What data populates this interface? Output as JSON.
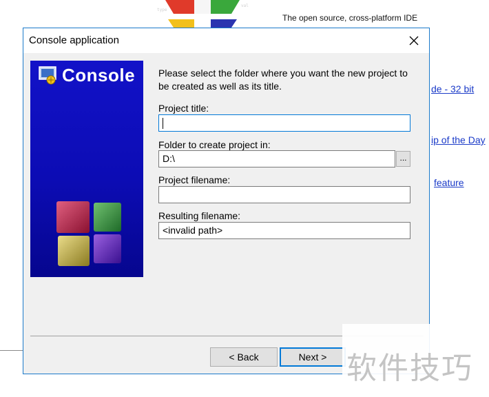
{
  "background": {
    "tagline": "The open source, cross-platform IDE",
    "links": [
      "de - 32 bit",
      "ip of the Day",
      "feature"
    ]
  },
  "dialog": {
    "title": "Console application",
    "side_title": "Console",
    "intro": "Please select the folder where you want the new project to be created as well as its title.",
    "project_title": {
      "label": "Project title:",
      "value": ""
    },
    "folder": {
      "label": "Folder to create project in:",
      "value": "D:\\",
      "browse_label": "..."
    },
    "project_filename": {
      "label": "Project filename:",
      "value": ""
    },
    "resulting_filename": {
      "label": "Resulting filename:",
      "value": "<invalid path>"
    },
    "buttons": {
      "back": "< Back",
      "next": "Next >"
    }
  },
  "watermark": "软件技巧",
  "colors": {
    "dialog_border": "#1979ca",
    "side_panel": "#0c0cb4",
    "link": "#1a3ac8",
    "focus": "#0078d7"
  }
}
